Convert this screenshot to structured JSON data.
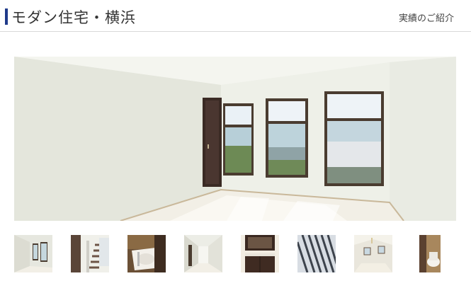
{
  "header": {
    "title": "モダン住宅・横浜",
    "subnav_label": "実績のご紹介",
    "accent_color": "#1f3a8a"
  },
  "gallery": {
    "main_image_icon": "photo-bedroom-white-windows",
    "thumbnails": [
      {
        "icon": "photo-room-window"
      },
      {
        "icon": "photo-staircase"
      },
      {
        "icon": "photo-washbasin"
      },
      {
        "icon": "photo-hallway"
      },
      {
        "icon": "photo-vanity-cabinet"
      },
      {
        "icon": "photo-louver-detail"
      },
      {
        "icon": "photo-attic-room"
      },
      {
        "icon": "photo-toilet"
      }
    ]
  }
}
